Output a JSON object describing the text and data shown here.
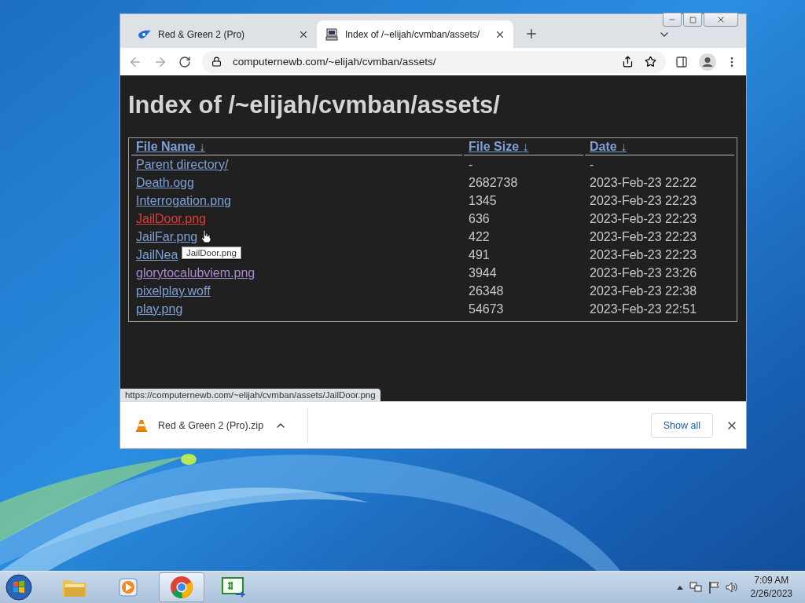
{
  "tabs": [
    {
      "title": "Red & Green 2 (Pro)",
      "selected": false
    },
    {
      "title": "Index of /~elijah/cvmban/assets/",
      "selected": true
    }
  ],
  "address_bar": {
    "url": "computernewb.com/~elijah/cvmban/assets/"
  },
  "page": {
    "heading": "Index of /~elijah/cvmban/assets/",
    "columns": [
      {
        "label": "File Name",
        "sort_arrow": "↓"
      },
      {
        "label": "File Size",
        "sort_arrow": "↓"
      },
      {
        "label": "Date",
        "sort_arrow": "↓"
      }
    ],
    "rows": [
      {
        "name": "Parent directory/",
        "hovered": false,
        "visited": false,
        "size": "-",
        "date": "-"
      },
      {
        "name": "Death.ogg",
        "hovered": false,
        "visited": false,
        "size": "2682738",
        "date": "2023-Feb-23 22:22"
      },
      {
        "name": "Interrogation.png",
        "hovered": false,
        "visited": false,
        "size": "1345",
        "date": "2023-Feb-23 22:23"
      },
      {
        "name": "JailDoor.png",
        "hovered": true,
        "visited": false,
        "size": "636",
        "date": "2023-Feb-23 22:23"
      },
      {
        "name": "JailFar.png",
        "hovered": false,
        "visited": false,
        "size": "422",
        "date": "2023-Feb-23 22:23"
      },
      {
        "name": "JailNea",
        "hovered": false,
        "visited": false,
        "size": "491",
        "date": "2023-Feb-23 22:23"
      },
      {
        "name": "glorytocalubviem.png",
        "hovered": false,
        "visited": true,
        "size": "3944",
        "date": "2023-Feb-23 23:26"
      },
      {
        "name": "pixelplay.woff",
        "hovered": false,
        "visited": false,
        "size": "26348",
        "date": "2023-Feb-23 22:38"
      },
      {
        "name": "play.png",
        "hovered": false,
        "visited": false,
        "size": "54673",
        "date": "2023-Feb-23 22:51"
      }
    ],
    "tooltip": "JailDoor.png"
  },
  "status_url": "https://computernewb.com/~elijah/cvmban/assets/JailDoor.png",
  "downloads": [
    {
      "name": "Red & Green 2 (Pro).zip"
    }
  ],
  "show_all": "Show all",
  "taskbar": {
    "apps": [
      {
        "kind": "explorer",
        "active": false
      },
      {
        "kind": "media",
        "active": false
      },
      {
        "kind": "chrome",
        "active": true
      },
      {
        "kind": "csharp",
        "active": false
      }
    ],
    "time": "7:09 AM",
    "date": "2/26/2023"
  }
}
